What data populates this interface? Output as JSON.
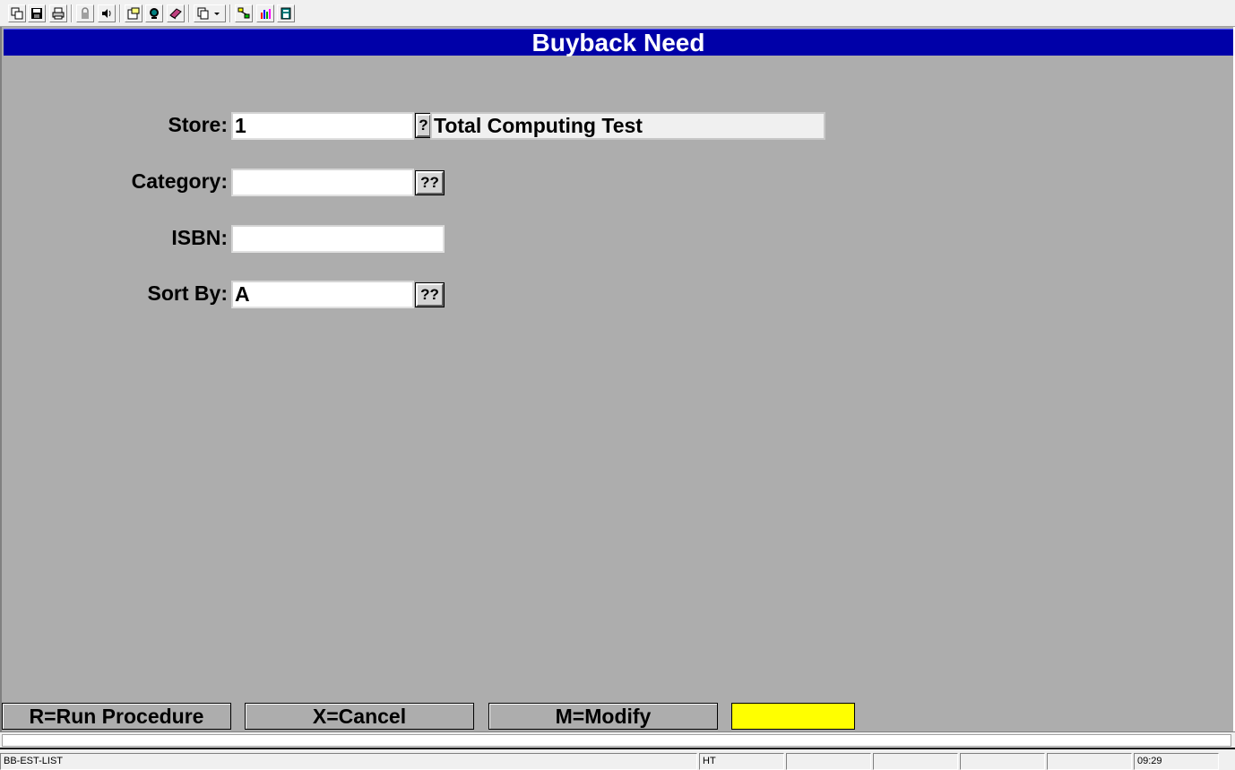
{
  "toolbar": {
    "buttons": [
      {
        "name": "new-window-icon"
      },
      {
        "name": "save-icon"
      },
      {
        "name": "print-icon"
      },
      {
        "name": "lock-icon"
      },
      {
        "name": "sound-icon"
      },
      {
        "name": "properties-icon"
      },
      {
        "name": "monitor-icon"
      },
      {
        "name": "book-icon"
      },
      {
        "name": "copy-dropdown-icon"
      },
      {
        "name": "network-icon"
      },
      {
        "name": "chart-icon"
      },
      {
        "name": "calculator-icon"
      }
    ]
  },
  "window": {
    "title": "Buyback Need"
  },
  "form": {
    "store": {
      "label": "Store:",
      "value": "1",
      "lookup": "?",
      "description": "Total Computing Test"
    },
    "category": {
      "label": "Category:",
      "value": "",
      "lookup": "??"
    },
    "isbn": {
      "label": "ISBN:",
      "value": ""
    },
    "sort_by": {
      "label": "Sort By:",
      "value": "A",
      "lookup": "??"
    }
  },
  "function_keys": {
    "run": "R=Run Procedure",
    "cancel": "X=Cancel",
    "modify": "M=Modify"
  },
  "colors": {
    "title_bar": "#0000a8",
    "form_bg": "#adadad",
    "highlight": "#ffff00"
  },
  "statusbar": {
    "program": "BB-EST-LIST",
    "mode": "HT",
    "time": "09:29"
  }
}
